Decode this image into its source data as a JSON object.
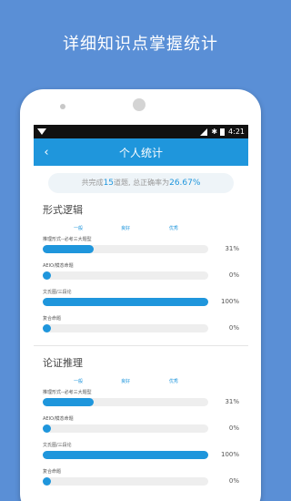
{
  "headline": "详细知识点掌握统计",
  "status_bar": {
    "time": "4:21"
  },
  "app_bar": {
    "back_icon": "‹",
    "title": "个人统计"
  },
  "summary": {
    "prefix": "共完成",
    "count": "15",
    "middle": "道题, 总正确率为",
    "rate": "26.67%"
  },
  "sections": [
    {
      "title": "形式逻辑",
      "legend": [
        "一般",
        "良好",
        "优秀"
      ],
      "rows": [
        {
          "label": "推理形式--必考三大题型",
          "value": 31,
          "pct": "31%"
        },
        {
          "label": "AEIO/模态命题",
          "value": 0,
          "pct": "0%"
        },
        {
          "label": "文氏图/三段论",
          "value": 100,
          "pct": "100%"
        },
        {
          "label": "复合命题",
          "value": 0,
          "pct": "0%"
        }
      ]
    },
    {
      "title": "论证推理",
      "legend": [
        "一般",
        "良好",
        "优秀"
      ],
      "rows": [
        {
          "label": "推理形式--必考三大题型",
          "value": 31,
          "pct": "31%"
        },
        {
          "label": "AEIO/模态命题",
          "value": 0,
          "pct": "0%"
        },
        {
          "label": "文氏图/三段论",
          "value": 100,
          "pct": "100%"
        },
        {
          "label": "复合命题",
          "value": 0,
          "pct": "0%"
        }
      ]
    }
  ],
  "colors": {
    "background": "#5a8fd6",
    "accent": "#1f96dc"
  }
}
